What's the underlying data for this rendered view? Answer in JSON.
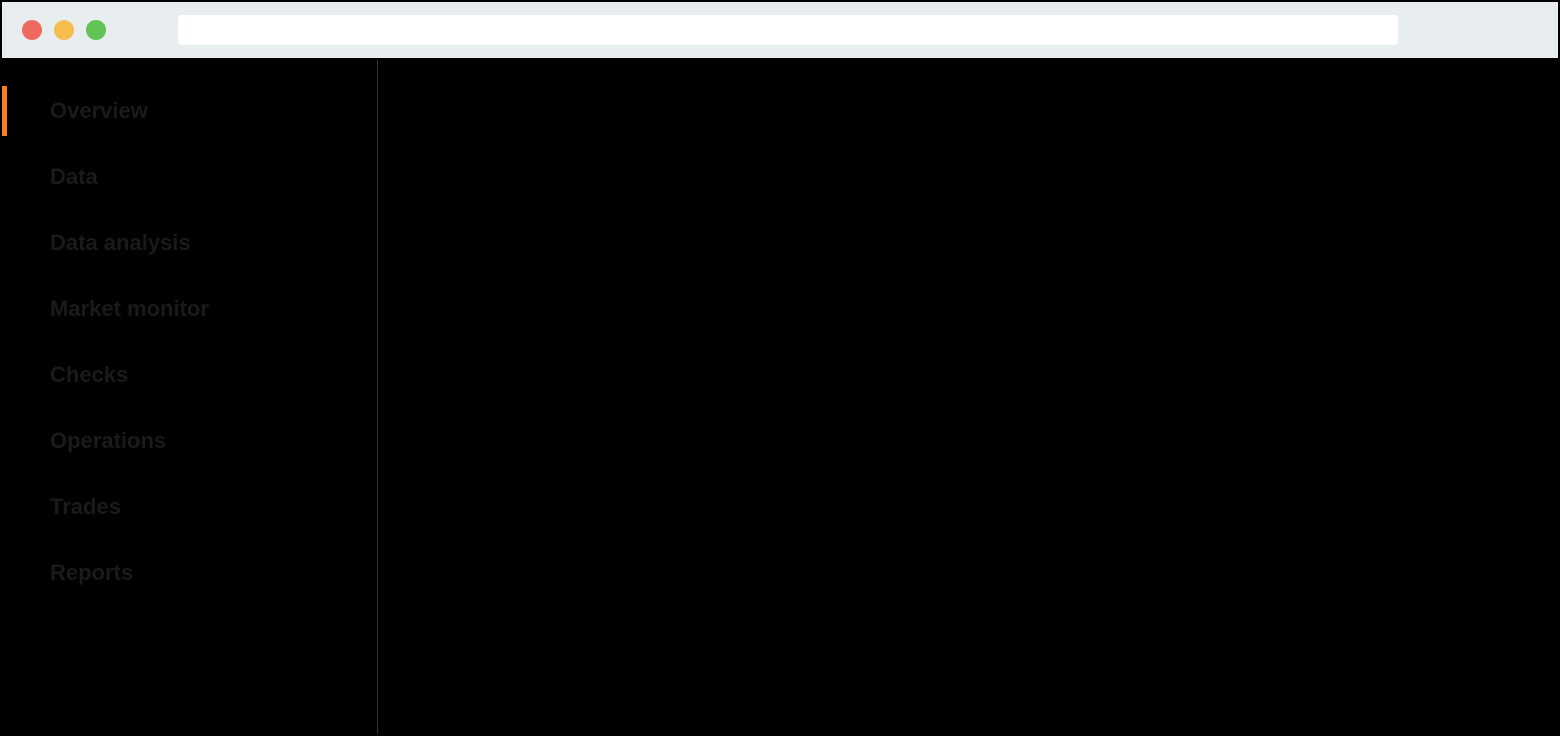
{
  "titlebar": {
    "address_value": ""
  },
  "sidebar": {
    "items": [
      {
        "label": "Overview",
        "active": true
      },
      {
        "label": "Data",
        "active": false
      },
      {
        "label": "Data analysis",
        "active": false
      },
      {
        "label": "Market monitor",
        "active": false
      },
      {
        "label": "Checks",
        "active": false
      },
      {
        "label": "Operations",
        "active": false
      },
      {
        "label": "Trades",
        "active": false
      },
      {
        "label": "Reports",
        "active": false
      }
    ]
  },
  "colors": {
    "accent": "#f58220"
  }
}
